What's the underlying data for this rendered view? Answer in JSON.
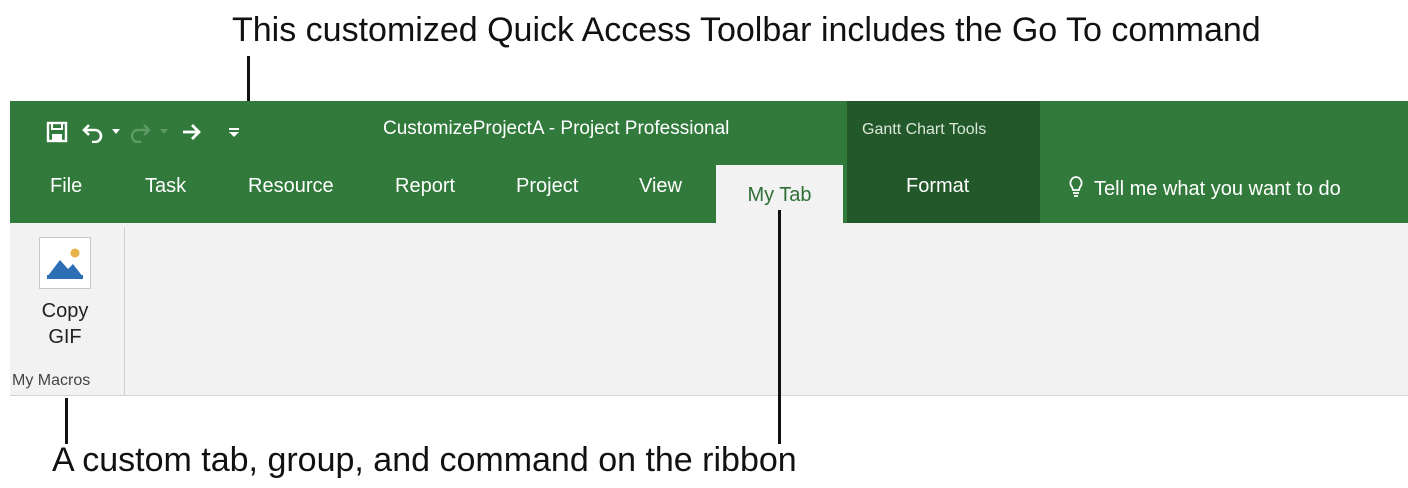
{
  "callouts": {
    "top": "This customized Quick Access Toolbar includes the Go To command",
    "bottom": "A custom tab, group, and command on the ribbon"
  },
  "titlebar": {
    "title": "CustomizeProjectA - Project Professional",
    "contextual_tab_title": "Gantt Chart Tools"
  },
  "quick_access_toolbar": [
    {
      "icon": "save-icon"
    },
    {
      "icon": "undo-icon"
    },
    {
      "icon": "undo-dropdown-icon"
    },
    {
      "icon": "redo-icon"
    },
    {
      "icon": "redo-dropdown-icon"
    },
    {
      "icon": "go-to-icon"
    },
    {
      "icon": "customize-qat-icon"
    }
  ],
  "tabs": {
    "file": "File",
    "task": "Task",
    "resource": "Resource",
    "report": "Report",
    "project": "Project",
    "view": "View",
    "my_tab": "My Tab",
    "format": "Format"
  },
  "tell_me": {
    "icon": "lightbulb-icon",
    "text": "Tell me what you want to do"
  },
  "ribbon": {
    "groups": [
      {
        "label": "My Macros",
        "commands": [
          {
            "label_line1": "Copy",
            "label_line2": "GIF",
            "icon": "picture-icon"
          }
        ]
      }
    ]
  },
  "colors": {
    "title_bar": "#317a3b",
    "contextual_band": "#23582b",
    "ribbon_background": "#f2f2f2",
    "active_tab_text": "#2f6e36"
  }
}
